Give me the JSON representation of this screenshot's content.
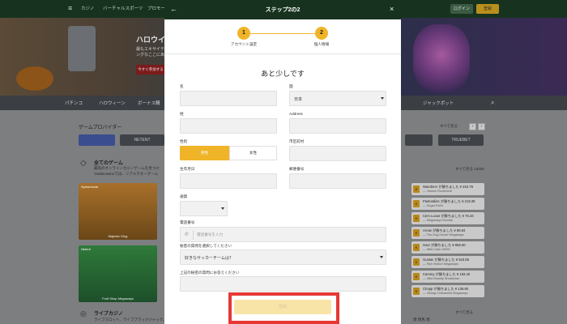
{
  "site": {
    "header": {
      "nav": [
        "カジノ",
        "バーチャルスポーツ",
        "プロモー"
      ],
      "login_label": "ログイン",
      "register_label": "登録"
    },
    "hero": {
      "title": "ハロウイ",
      "subtitle": "最もエキサイティングなここにある",
      "cta_label": "今すぐ参加する"
    },
    "category_bar": {
      "items": [
        "パチンコ",
        "ハロウィーン",
        "ボーナス購"
      ],
      "jackpot_label": "ジャックポット"
    },
    "providers": {
      "title": "ゲームプロバイダー",
      "see_all": "すべて見る",
      "logos": [
        "",
        "NETENT",
        "",
        "",
        "TRUEBET"
      ],
      "pager_prev": "‹",
      "pager_next": "›"
    },
    "all_games": {
      "title": "全てのゲーム",
      "desc1": "最高のオンラインカジノゲームを見つけ",
      "desc2": "Yoakecasinoでは、リアルマネーゲーム",
      "see_all": "すべて見る 13030",
      "games": [
        {
          "badge": "Spinomenal",
          "name": "Majestic King"
        },
        {
          "badge": "Netent",
          "name": "Fruit Shop Megaways"
        }
      ]
    },
    "live_casino": {
      "title": "ライブカジノ",
      "desc": "ライブスロット、ライブブラックジャック、",
      "see_all": "すべて見る",
      "extra": "博 博馬 博"
    },
    "recent_winners": [
      {
        "line1": "Wanderer が勝ちました ¥ 453.78",
        "line2": "— Tanzen Rockenroll"
      },
      {
        "line1": "Pastoralize が勝ちました ¥ 219.38",
        "line2": "— Sugar Rush"
      },
      {
        "line1": "Cem Lucas が勝ちました ¥ 76.33",
        "line2": "— Megaways Secrets"
      },
      {
        "line1": "Arrow が勝ちました ¥ 89.94",
        "line2": "— The Dog House Megaways"
      },
      {
        "line1": "Sour が勝ちました ¥ 866.00",
        "line2": "— Wild Cash x9990"
      },
      {
        "line1": "Gustav が勝ちました ¥ 518.66",
        "line2": "— Rich Hutton Megaways"
      },
      {
        "line1": "Cammy が勝ちました ¥ 183.40",
        "line2": "— Wild Beastly Showdown"
      },
      {
        "line1": "Chopp が勝ちました ¥ 138.90",
        "line2": "— Vikings Unleashed Megaways"
      }
    ]
  },
  "modal": {
    "title": "ステップ2の2",
    "back_icon": "arrow-left-icon",
    "close_icon": "close-icon",
    "steps": [
      {
        "number": "1",
        "label": "アカウント設定"
      },
      {
        "number": "2",
        "label": "個人情報"
      }
    ],
    "accent_color": "#f0b429",
    "heading": "あと少しです",
    "form": {
      "first_name": {
        "label": "名",
        "value": ""
      },
      "country": {
        "label": "国",
        "value": "日本"
      },
      "last_name": {
        "label": "姓",
        "value": ""
      },
      "address": {
        "label": "Address",
        "value": ""
      },
      "gender": {
        "label": "性別",
        "male": "男性",
        "female": "女性",
        "selected": "男性"
      },
      "city": {
        "label": "市区町村",
        "value": ""
      },
      "birthdate": {
        "label": "生年月日",
        "value": ""
      },
      "postal_code": {
        "label": "郵便番号",
        "value": ""
      },
      "currency": {
        "label": "通貨",
        "value": ""
      },
      "phone": {
        "label": "電話番号",
        "placeholder": "電話番号を入力"
      },
      "security_question": {
        "label": "秘密の質問を選択してください",
        "value": "好きなサッカーチームは？"
      },
      "security_answer": {
        "label": "上記の秘密の質問にお答えください",
        "value": ""
      }
    },
    "submit_label": "登録"
  }
}
